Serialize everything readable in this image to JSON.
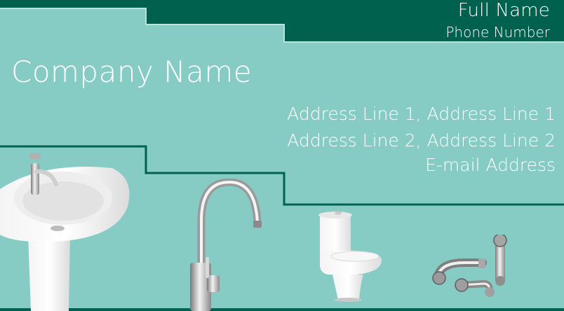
{
  "card": {
    "full_name": "Full Name",
    "phone_number": "Phone Number",
    "company_name": "Company Name",
    "address_line_1": "Address Line 1,  Address Line 1",
    "address_line_2": "Address Line 2,   Address Line 2",
    "email": "E-mail Address"
  },
  "colors": {
    "background": "#86cbc4",
    "dark_green": "#00614f",
    "text": "#ffffff"
  },
  "products": [
    {
      "icon": "sink-icon"
    },
    {
      "icon": "faucet-icon"
    },
    {
      "icon": "toilet-icon"
    },
    {
      "icon": "pipe-fittings-icon"
    }
  ]
}
